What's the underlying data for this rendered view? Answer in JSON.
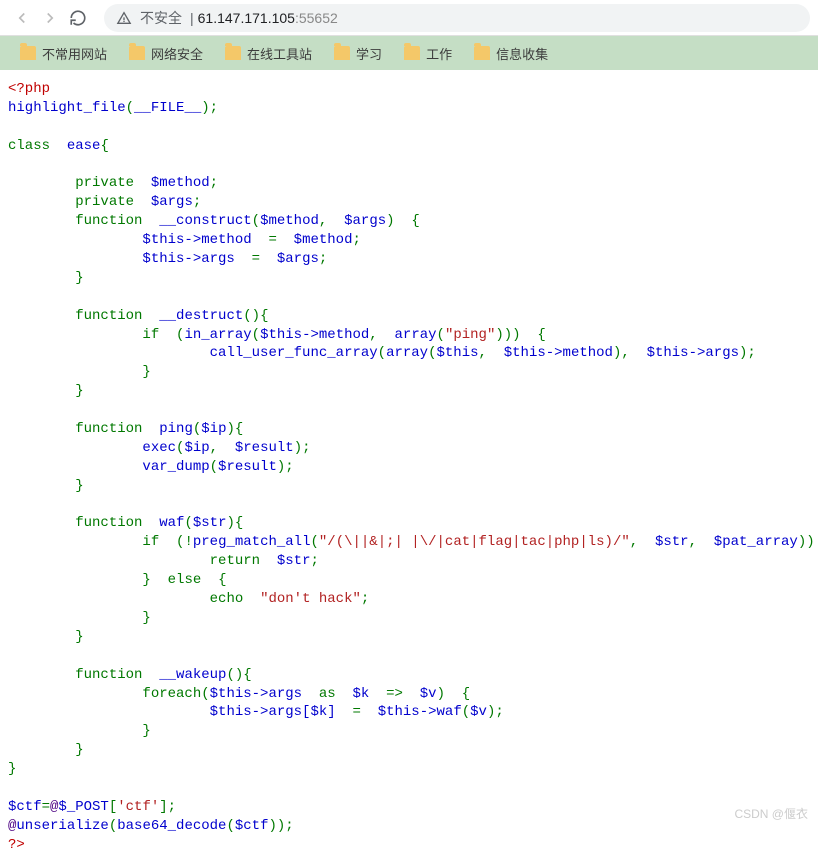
{
  "browser": {
    "insecure_label": "不安全",
    "host": "61.147.171.105",
    "port": ":55652"
  },
  "bookmarks": {
    "items": [
      {
        "label": "不常用网站"
      },
      {
        "label": "网络安全"
      },
      {
        "label": "在线工具站"
      },
      {
        "label": "学习"
      },
      {
        "label": "工作"
      },
      {
        "label": "信息收集"
      }
    ]
  },
  "code_tokens": {
    "php_open": "<?php",
    "highlight": "highlight_file",
    "file_const": "__FILE__",
    "kw_class": "class",
    "cls_name": "ease",
    "kw_private": "private",
    "var_method": "$method",
    "var_args": "$args",
    "kw_function": "function",
    "fn_construct": "__construct",
    "this_method": "$this->method",
    "this_args": "$this->args",
    "fn_destruct": "__destruct",
    "kw_if": "if",
    "fn_inarray": "in_array",
    "fn_array": "array",
    "str_ping": "\"ping\"",
    "fn_calluser": "call_user_func_array",
    "var_this": "$this",
    "fn_ping": "ping",
    "var_ip": "$ip",
    "fn_exec": "exec",
    "var_result": "$result",
    "fn_vardump": "var_dump",
    "fn_waf": "waf",
    "var_str": "$str",
    "fn_pregmatch": "preg_match_all",
    "str_regex": "\"/(\\||&|;| |\\/|cat|flag|tac|php|ls)/\"",
    "var_patarray": "$pat_array",
    "kw_return": "return",
    "kw_else": "else",
    "kw_echo": "echo",
    "str_donthack": "\"don't hack\"",
    "fn_wakeup": "__wakeup",
    "kw_foreach": "foreach",
    "kw_as": "as",
    "var_k": "$k",
    "var_v": "$v",
    "this_args_k": "$this->args[$k]",
    "this_waf": "$this->waf",
    "var_ctf": "$ctf",
    "at": "@",
    "post": "$_POST",
    "str_ctf": "'ctf'",
    "fn_unserialize": "unserialize",
    "fn_base64": "base64_decode",
    "php_close": "?>"
  },
  "watermark": "CSDN @偃衣"
}
